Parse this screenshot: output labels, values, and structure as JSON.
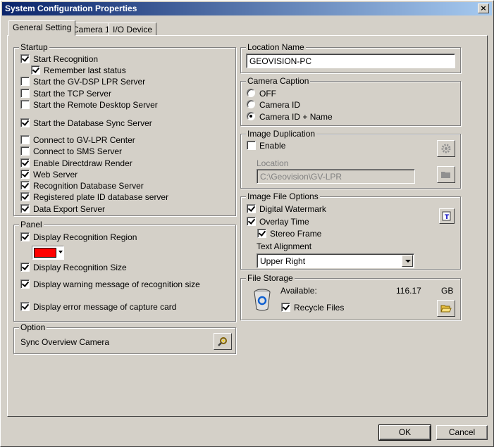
{
  "window": {
    "title": "System Configuration Properties",
    "close_glyph": "×"
  },
  "tabs": [
    {
      "label": "General Setting",
      "active": true
    },
    {
      "label": "Camera 1",
      "active": false
    },
    {
      "label": "I/O Device",
      "active": false
    }
  ],
  "startup": {
    "label": "Startup",
    "items": [
      {
        "label": "Start Recognition",
        "checked": true
      },
      {
        "label": "Remember last status",
        "checked": true
      },
      {
        "label": "Start the GV-DSP LPR Server",
        "checked": false
      },
      {
        "label": "Start the TCP Server",
        "checked": false
      },
      {
        "label": "Start the Remote Desktop Server",
        "checked": false
      },
      {
        "label": "Start the Database Sync Server",
        "checked": true
      },
      {
        "label": "Connect to GV-LPR Center",
        "checked": false
      },
      {
        "label": "Connect to SMS Server",
        "checked": false
      },
      {
        "label": "Enable Directdraw Render",
        "checked": true
      },
      {
        "label": "Web Server",
        "checked": true
      },
      {
        "label": "Recognition Database Server",
        "checked": true
      },
      {
        "label": "Registered plate ID database server",
        "checked": true
      },
      {
        "label": "Data Export Server",
        "checked": true
      }
    ]
  },
  "panel": {
    "label": "Panel",
    "items": [
      {
        "label": "Display Recognition Region",
        "checked": true
      },
      {
        "label": "Display Recognition Size",
        "checked": true
      },
      {
        "label": "Display warning message of recognition size",
        "checked": true
      },
      {
        "label": "Display error message of capture card",
        "checked": true
      }
    ],
    "region_color": "#ff0000"
  },
  "option": {
    "label": "Option",
    "sync_label": "Sync Overview Camera"
  },
  "location": {
    "label": "Location Name",
    "value": "GEOVISION-PC"
  },
  "caption": {
    "label": "Camera Caption",
    "options": [
      {
        "label": "OFF",
        "selected": false
      },
      {
        "label": "Camera ID",
        "selected": false
      },
      {
        "label": "Camera ID + Name",
        "selected": true
      }
    ]
  },
  "duplication": {
    "label": "Image Duplication",
    "enable_label": "Enable",
    "enable_checked": false,
    "location_label": "Location",
    "location_value": "C:\\Geovision\\GV-LPR"
  },
  "image_file": {
    "label": "Image File Options",
    "items": [
      {
        "label": "Digital Watermark",
        "checked": true
      },
      {
        "label": "Overlay Time",
        "checked": true
      },
      {
        "label": "Stereo Frame",
        "checked": true
      }
    ],
    "align_label": "Text Alignment",
    "align_value": "Upper Right"
  },
  "storage": {
    "label": "File Storage",
    "available_label": "Available:",
    "available_value": "116.17",
    "unit": "GB",
    "recycle_label": "Recycle Files",
    "recycle_checked": true
  },
  "buttons": {
    "ok": "OK",
    "cancel": "Cancel"
  }
}
